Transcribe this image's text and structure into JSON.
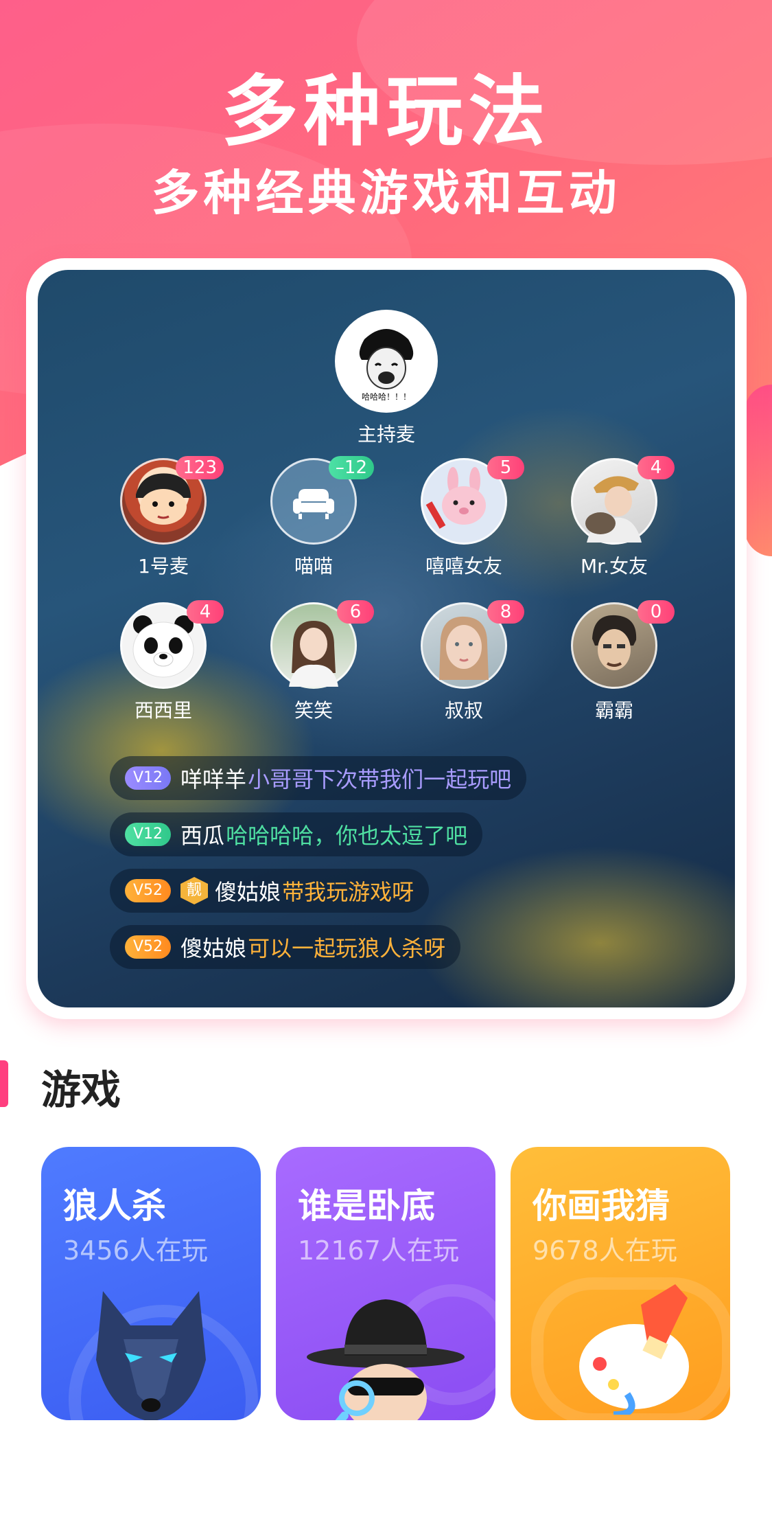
{
  "hero": {
    "title": "多种玩法",
    "subtitle": "多种经典游戏和互动"
  },
  "room": {
    "host": {
      "name": "主持麦",
      "caption": "哈哈哈！！！"
    },
    "seats": [
      {
        "name": "1号麦",
        "count": "123",
        "count_color": "pink"
      },
      {
        "name": "喵喵",
        "count": "–12",
        "count_color": "green"
      },
      {
        "name": "嘻嘻女友",
        "count": "5",
        "count_color": "pink"
      },
      {
        "name": "Mr.女友",
        "count": "4",
        "count_color": "pink"
      },
      {
        "name": "西西里",
        "count": "4",
        "count_color": "pink"
      },
      {
        "name": "笑笑",
        "count": "6",
        "count_color": "pink"
      },
      {
        "name": "叔叔",
        "count": "8",
        "count_color": "pink"
      },
      {
        "name": "霸霸",
        "count": "0",
        "count_color": "pink"
      }
    ],
    "messages": [
      {
        "level": "V12",
        "level_color": "purple",
        "user": "咩咩羊",
        "text": "小哥哥下次带我们一起玩吧",
        "text_color": "#a99cff"
      },
      {
        "level": "V12",
        "level_color": "green",
        "user": "西瓜",
        "text": "哈哈哈哈，你也太逗了吧",
        "text_color": "#4fe0a2"
      },
      {
        "level": "V52",
        "level_color": "orange",
        "badge": "靓",
        "user": "傻姑娘",
        "text": "带我玩游戏呀",
        "text_color": "#ffb23a"
      },
      {
        "level": "V52",
        "level_color": "orange",
        "user": "傻姑娘",
        "text": "可以一起玩狼人杀呀",
        "text_color": "#ffb23a"
      }
    ]
  },
  "games_section": {
    "title": "游戏",
    "games": [
      {
        "name": "狼人杀",
        "players": "3456人在玩",
        "icon": "wolf-icon"
      },
      {
        "name": "谁是卧底",
        "players": "12167人在玩",
        "icon": "spy-icon"
      },
      {
        "name": "你画我猜",
        "players": "9678人在玩",
        "icon": "paint-palette-icon"
      }
    ]
  }
}
